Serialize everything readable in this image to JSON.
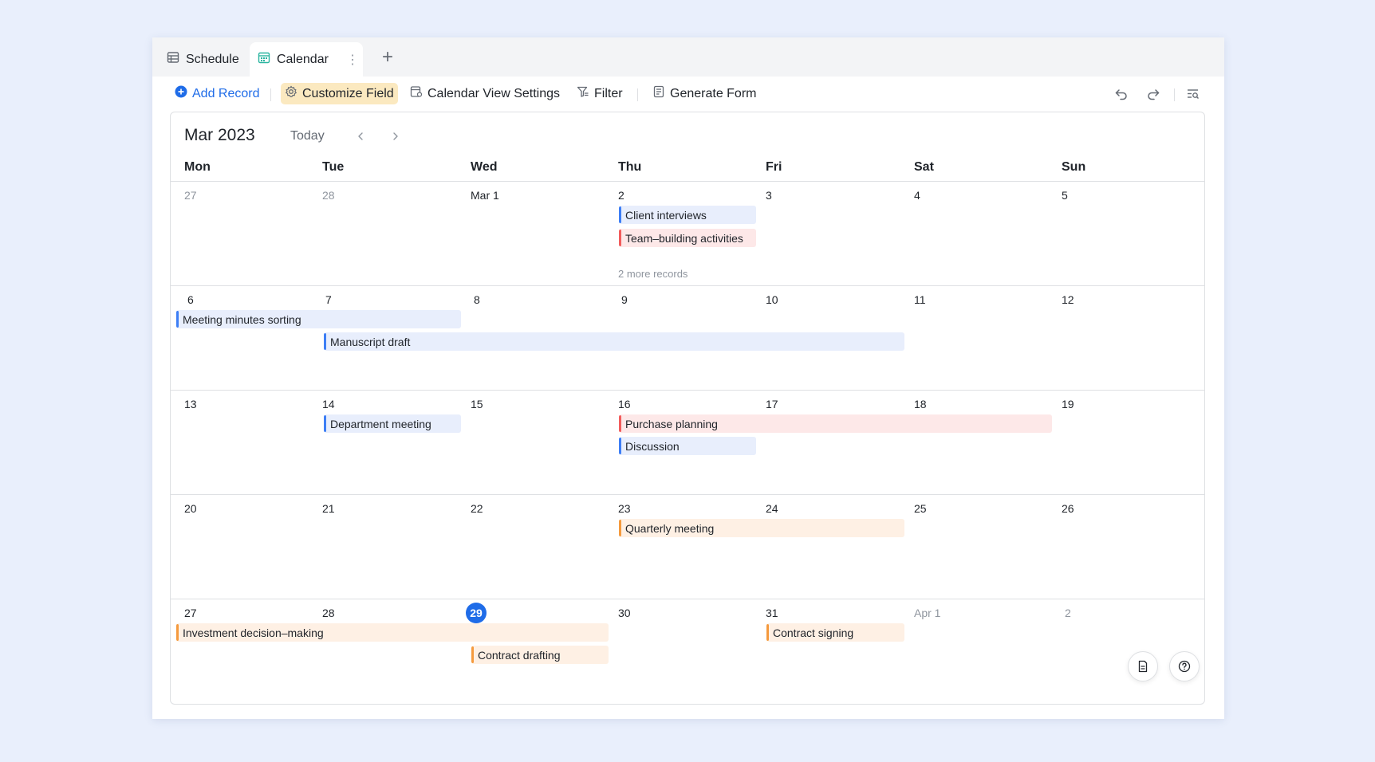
{
  "tabs": [
    {
      "label": "Schedule",
      "icon": "table-icon",
      "active": false
    },
    {
      "label": "Calendar",
      "icon": "calendar-icon",
      "active": true,
      "more": "⋮"
    }
  ],
  "tab_add": "+",
  "toolbar": {
    "add_record": "Add Record",
    "customize_field": "Customize Field",
    "calendar_view_settings": "Calendar View Settings",
    "filter": "Filter",
    "generate_form": "Generate Form"
  },
  "calendar": {
    "month_title": "Mar 2023",
    "today_label": "Today",
    "weekdays": [
      "Mon",
      "Tue",
      "Wed",
      "Thu",
      "Fri",
      "Sat",
      "Sun"
    ],
    "weeks": [
      [
        "27",
        "28",
        "Mar 1",
        "2",
        "3",
        "4",
        "5"
      ],
      [
        "6",
        "7",
        "8",
        "9",
        "10",
        "11",
        "12"
      ],
      [
        "13",
        "14",
        "15",
        "16",
        "17",
        "18",
        "19"
      ],
      [
        "20",
        "21",
        "22",
        "23",
        "24",
        "25",
        "26"
      ],
      [
        "27",
        "28",
        "29",
        "30",
        "31",
        "Apr 1",
        "2"
      ]
    ],
    "today_date": "29",
    "more_records": "2 more records",
    "events": [
      {
        "title": "Client interviews",
        "color": "blue"
      },
      {
        "title": "Team–building activities",
        "color": "red"
      },
      {
        "title": "Meeting minutes sorting",
        "color": "blue"
      },
      {
        "title": "Manuscript draft",
        "color": "blue"
      },
      {
        "title": "Department meeting",
        "color": "blue"
      },
      {
        "title": "Purchase planning",
        "color": "red"
      },
      {
        "title": "Discussion",
        "color": "blue"
      },
      {
        "title": "Quarterly meeting",
        "color": "orange"
      },
      {
        "title": "Investment decision–making",
        "color": "orange"
      },
      {
        "title": "Contract drafting",
        "color": "orange"
      },
      {
        "title": "Contract signing",
        "color": "orange"
      }
    ]
  },
  "colors": {
    "accent": "#1f6ce8",
    "event_blue": "#3d7ef5",
    "event_red": "#f25c5c",
    "event_orange": "#f59a3d"
  }
}
